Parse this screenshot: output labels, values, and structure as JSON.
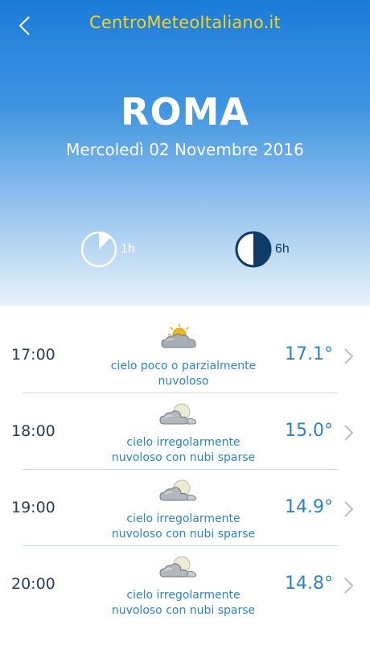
{
  "header": {
    "app_title": "CentroMeteoItaliano.it",
    "city": "ROMA",
    "date": "Mercoledì 02 Novembre 2016",
    "back_icon": "chevron-left-icon"
  },
  "intervals": [
    {
      "label": "1h",
      "icon": "clock-quarter-icon",
      "selected": false
    },
    {
      "label": "6h",
      "icon": "clock-half-icon",
      "selected": true
    }
  ],
  "colors": {
    "header_top": "#1c7bd9",
    "title_yellow": "#f5d323",
    "accent_blue": "#2e83c5",
    "dark_navy": "#0f3b68"
  },
  "forecast": [
    {
      "time": "17:00",
      "icon": "sun-behind-cloud-icon",
      "desc_line1": "cielo poco o parzialmente",
      "desc_line2": "nuvoloso",
      "temp": "17.1°"
    },
    {
      "time": "18:00",
      "icon": "moon-behind-cloud-icon",
      "desc_line1": "cielo irregolarmente",
      "desc_line2": "nuvoloso con nubi sparse",
      "temp": "15.0°"
    },
    {
      "time": "19:00",
      "icon": "moon-behind-cloud-icon",
      "desc_line1": "cielo irregolarmente",
      "desc_line2": "nuvoloso con nubi sparse",
      "temp": "14.9°"
    },
    {
      "time": "20:00",
      "icon": "moon-behind-cloud-icon",
      "desc_line1": "cielo irregolarmente",
      "desc_line2": "nuvoloso con nubi sparse",
      "temp": "14.8°"
    }
  ]
}
